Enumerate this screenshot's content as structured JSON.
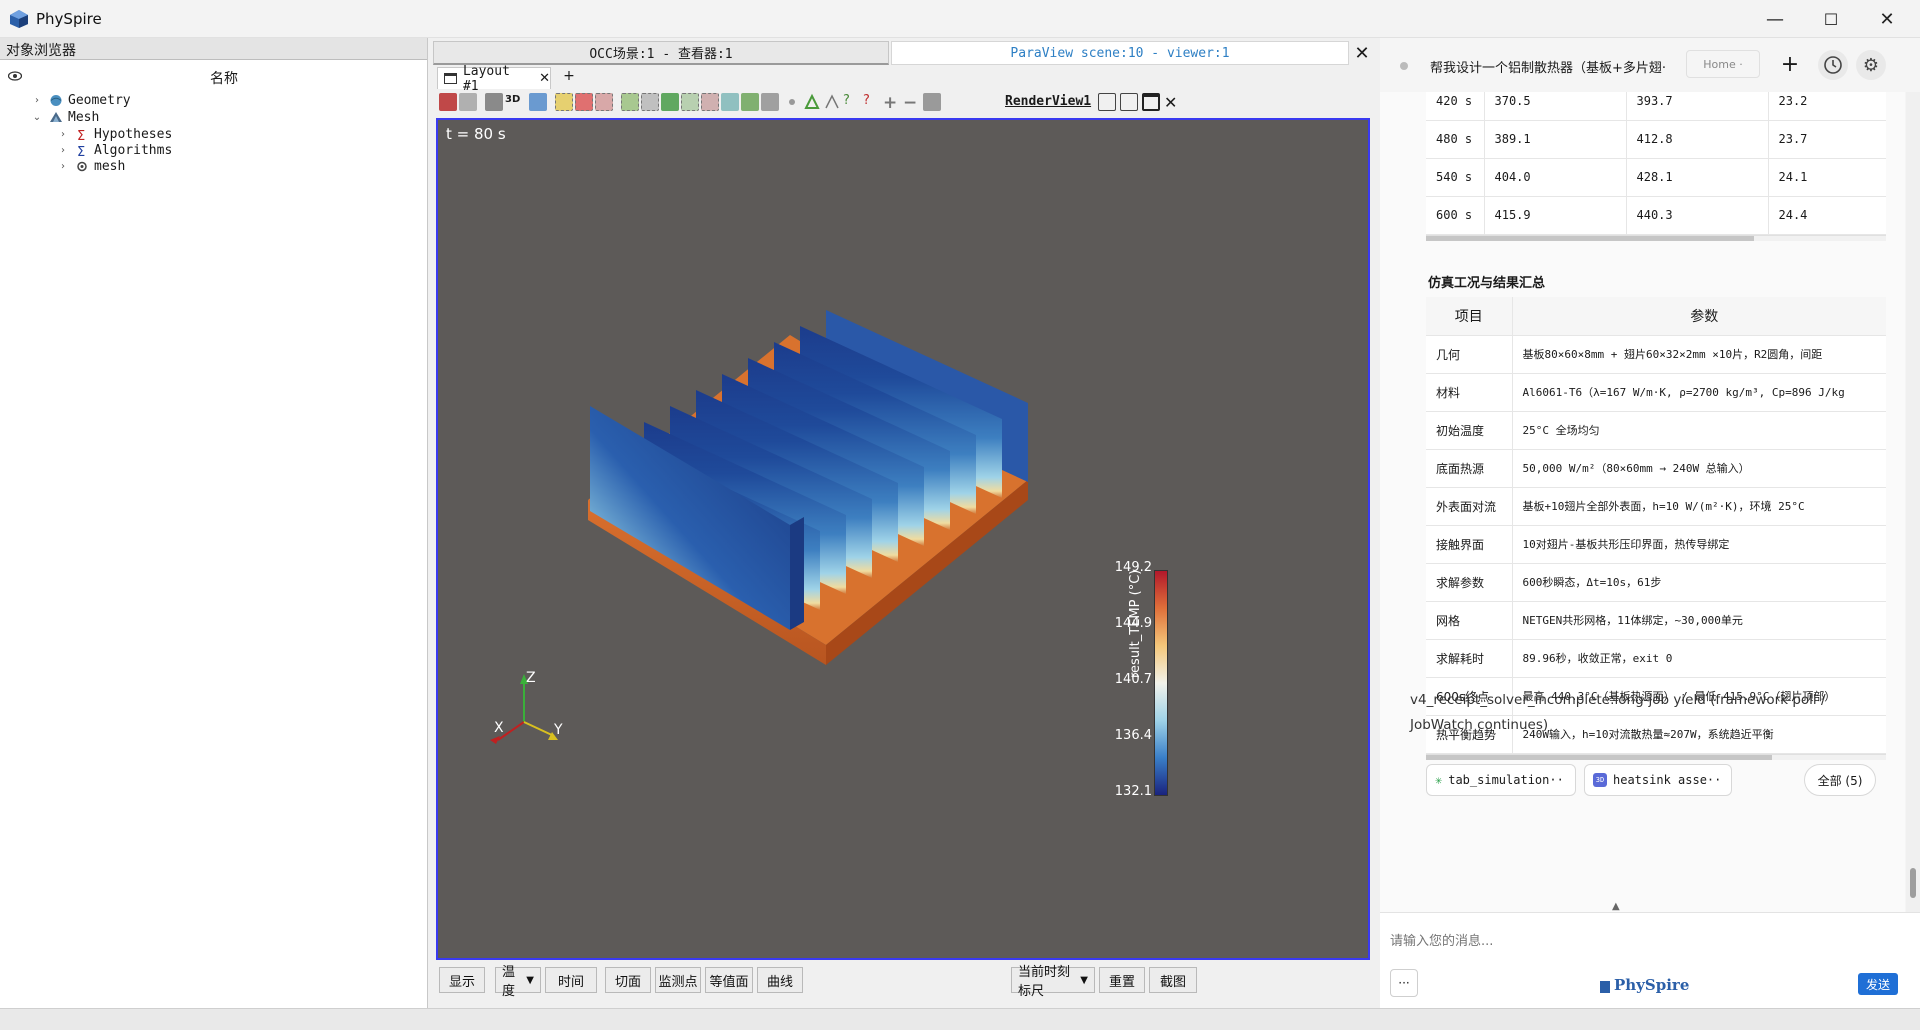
{
  "window": {
    "title": "PhySpire",
    "minimize": "—",
    "maximize": "☐",
    "close": "✕"
  },
  "left_panel": {
    "header": "对象浏览器",
    "column_name": "名称",
    "tree": [
      {
        "label": "Geometry",
        "arrow": "›",
        "icon": "geometry-icon"
      },
      {
        "label": "Mesh",
        "arrow": "⌄",
        "icon": "mesh-icon"
      },
      {
        "label": "Hypotheses",
        "arrow": "›",
        "icon": "hypotheses-icon"
      },
      {
        "label": "Algorithms",
        "arrow": "›",
        "icon": "algorithms-icon"
      },
      {
        "label": "mesh",
        "arrow": "›",
        "icon": "submesh-icon"
      }
    ]
  },
  "viewer": {
    "tab_occ": "OCC场景:1 - 查看器:1",
    "tab_paraview": "ParaView scene:10 - viewer:1",
    "layout_tab": "Layout #1",
    "add_tab": "+",
    "toolbar_3d": "3D",
    "render_view": "RenderView1",
    "time_label": "t = 80 s",
    "colorbar": {
      "title": "result_TEMP (°C)",
      "ticks": [
        "149.2",
        "144.9",
        "140.7",
        "136.4",
        "132.1"
      ],
      "colors": [
        "#b2182b",
        "#e0703a",
        "#f4c77a",
        "#f2f2ea",
        "#9fd3e8",
        "#3a7fc8",
        "#1a237e"
      ]
    },
    "axes": {
      "x": "X",
      "y": "Y",
      "z": "Z"
    },
    "bottom_buttons": {
      "display": "显示",
      "temperature": "温度",
      "time": "时间",
      "slice": "切面",
      "probe": "监测点",
      "contour": "等值面",
      "curve": "曲线",
      "current_scale": "当前时刻标尺",
      "reset": "重置",
      "screenshot": "截图"
    }
  },
  "chat": {
    "header_title": "帮我设计一个铝制散热器（基板+多片翅·",
    "home_btn": "Home ·",
    "plus_btn": "+",
    "time_rows": [
      [
        "420 s",
        "370.5",
        "393.7",
        "23.2"
      ],
      [
        "480 s",
        "389.1",
        "412.8",
        "23.7"
      ],
      [
        "540 s",
        "404.0",
        "428.1",
        "24.1"
      ],
      [
        "600 s",
        "415.9",
        "440.3",
        "24.4"
      ]
    ],
    "summary_title": "仿真工况与结果汇总",
    "summary_head": [
      "项目",
      "参数"
    ],
    "summary_rows": [
      [
        "几何",
        "基板80×60×8mm + 翅片60×32×2mm ×10片，R2圆角，间距"
      ],
      [
        "材料",
        "Al6061-T6（λ=167 W/m·K, ρ=2700 kg/m³, Cp=896 J/kg"
      ],
      [
        "初始温度",
        "25°C 全场均匀"
      ],
      [
        "底面热源",
        "50,000 W/m²（80×60mm → 240W 总输入）"
      ],
      [
        "外表面对流",
        "基板+10翅片全部外表面，h=10 W/(m²·K)，环境 25°C"
      ],
      [
        "接触界面",
        "10对翅片-基板共形压印界面，热传导绑定"
      ],
      [
        "求解参数",
        "600秒瞬态，Δt=10s，61步"
      ],
      [
        "网格",
        "NETGEN共形网格，11体绑定，~30,000单元"
      ],
      [
        "求解耗时",
        "89.96秒，收敛正常，exit 0"
      ],
      [
        "600s终点",
        "最高 440.3°C（基板热源面） / 最低 415.9°C（翅片顶部）"
      ],
      [
        "热平衡趋势",
        "240W输入，h=10对流散热量≈207W，系统趋近平衡"
      ]
    ],
    "receipt_line1": "v4_receipt_solver_incomplete:long-job yield (framework poll /",
    "receipt_line2": "JobWatch continues)",
    "chip1": "tab_simulation··",
    "chip2": "heatsink asse··",
    "chip_all": "全部 (5)",
    "caret_up": "▲",
    "input_placeholder": "请输入您的消息...",
    "more_btn": "···",
    "brand": "PhySpire",
    "send_btn": "发送"
  }
}
